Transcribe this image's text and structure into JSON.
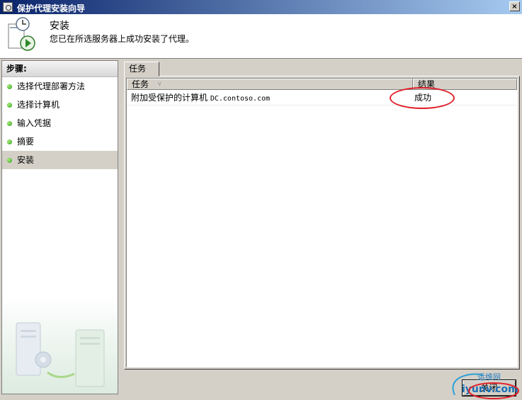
{
  "window": {
    "title": "保护代理安装向导",
    "close_glyph": "×"
  },
  "header": {
    "title": "安装",
    "subtitle": "您已在所选服务器上成功安装了代理。"
  },
  "sidebar": {
    "heading": "步骤:",
    "items": [
      {
        "label": "选择代理部署方法",
        "active": false
      },
      {
        "label": "选择计算机",
        "active": false
      },
      {
        "label": "输入凭据",
        "active": false
      },
      {
        "label": "摘要",
        "active": false
      },
      {
        "label": "安装",
        "active": true
      }
    ]
  },
  "tab": {
    "label": "任务"
  },
  "table": {
    "columns": [
      "任务",
      "结果"
    ],
    "sort_indicator": "∨",
    "rows": [
      {
        "task": "附加受保护的计算机",
        "computer": "DC.contoso.com",
        "result": "成功"
      }
    ]
  },
  "buttons": {
    "close_label": "关闭"
  },
  "watermark": {
    "text": "运维网",
    "domain": "iyunv.com"
  },
  "colors": {
    "annotation": "#e0202a",
    "title_start": "#0a246a",
    "title_end": "#a6caf0",
    "step_dot": "#2f9a1a"
  }
}
